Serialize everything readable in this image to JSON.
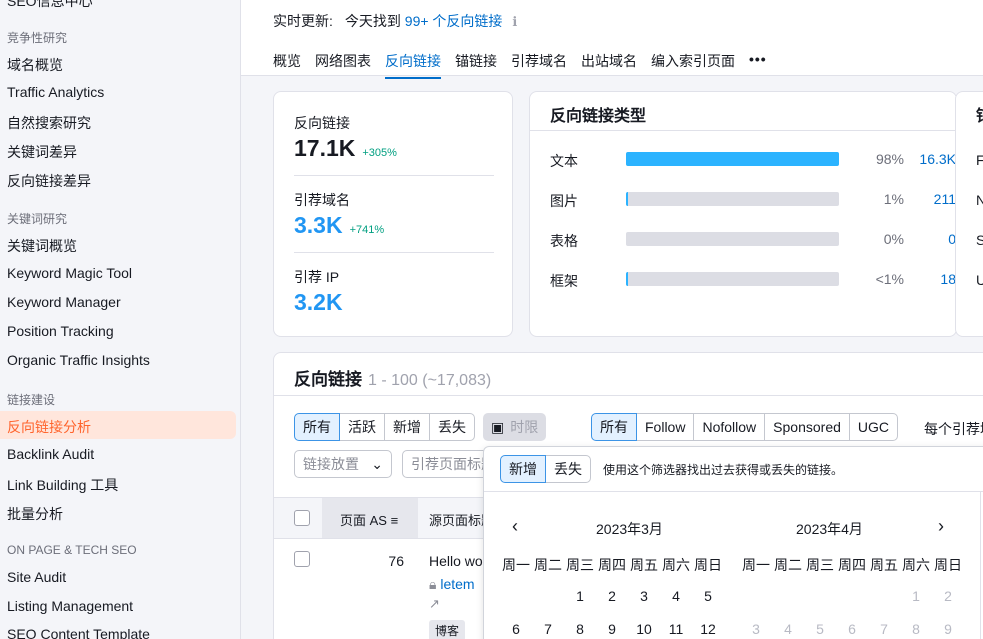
{
  "sidebar": {
    "top_cut": "SEO信息中心",
    "sections": [
      {
        "heading": "竞争性研究",
        "items": [
          "域名概览",
          "Traffic Analytics",
          "自然搜索研究",
          "关键词差异",
          "反向链接差异"
        ]
      },
      {
        "heading": "关键词研究",
        "items": [
          "关键词概览",
          "Keyword Magic Tool",
          "Keyword Manager",
          "Position Tracking",
          "Organic Traffic Insights"
        ]
      },
      {
        "heading": "链接建设",
        "items": [
          "反向链接分析",
          "Backlink Audit",
          "Link Building 工具",
          "批量分析"
        ]
      },
      {
        "heading": "ON PAGE & TECH SEO",
        "items": [
          "Site Audit",
          "Listing Management",
          "SEO Content Template"
        ]
      }
    ],
    "active_item": "反向链接分析"
  },
  "topbar": {
    "update_label": "实时更新:",
    "update_text": "今天找到",
    "update_link": "99+ 个反向链接",
    "info_icon": "info-icon",
    "tabs": [
      "概览",
      "网络图表",
      "反向链接",
      "锚链接",
      "引荐域名",
      "出站域名",
      "编入索引页面",
      "•••"
    ],
    "active_tab": "反向链接"
  },
  "kpis": {
    "backlinks": {
      "label": "反向链接",
      "value": "17.1K",
      "delta": "+305%"
    },
    "ref_domains": {
      "label": "引荐域名",
      "value": "3.3K",
      "delta": "+741%"
    },
    "ref_ips": {
      "label": "引荐 IP",
      "value": "3.2K"
    }
  },
  "types": {
    "title": "反向链接类型",
    "rows": [
      {
        "name": "文本",
        "pct": "98%",
        "count": "16.3K",
        "fill": 1.0
      },
      {
        "name": "图片",
        "pct": "1%",
        "count": "211",
        "fill": 0.01
      },
      {
        "name": "表格",
        "pct": "0%",
        "count": "0",
        "fill": 0
      },
      {
        "name": "框架",
        "pct": "<1%",
        "count": "18",
        "fill": 0.01
      }
    ]
  },
  "right_card": {
    "title": "锚",
    "letters": [
      "F",
      "N",
      "S",
      "U"
    ]
  },
  "backlinks": {
    "title": "反向链接",
    "range": "1 - 100 (~17,083)",
    "filter_status": [
      "所有",
      "活跃",
      "新增",
      "丢失"
    ],
    "date_button": "时限",
    "filter_type": [
      "所有",
      "Follow",
      "Nofollow",
      "Sponsored",
      "UGC"
    ],
    "per_domain": "每个引荐域",
    "placement_select": "链接放置",
    "source_title_input": "引荐页面标题",
    "columns": {
      "page_as": "页面 AS",
      "source_title": "源页面标题"
    },
    "rows": [
      {
        "as": "76",
        "title": "Hello wo",
        "link": "letem",
        "tag": "博客"
      }
    ]
  },
  "picker": {
    "buttons": [
      "新增",
      "丢失"
    ],
    "hint": "使用这个筛选器找出过去获得或丢失的链接。",
    "months": [
      "2023年3月",
      "2023年4月"
    ],
    "weekdays": [
      "周一",
      "周二",
      "周三",
      "周四",
      "周五",
      "周六",
      "周日"
    ],
    "march_row1": [
      "",
      "",
      "1",
      "2",
      "3",
      "4",
      "5"
    ],
    "march_row2": [
      "6",
      "7",
      "8",
      "9",
      "10",
      "11",
      "12"
    ],
    "april_row1": [
      "",
      "",
      "",
      "",
      "",
      "1",
      "2"
    ],
    "april_row2": [
      "3",
      "4",
      "5",
      "6",
      "7",
      "8",
      "9"
    ]
  }
}
